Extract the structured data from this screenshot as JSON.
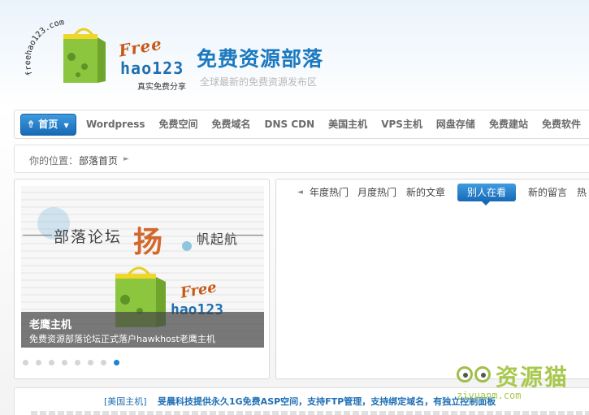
{
  "header": {
    "logo_arc_text": "freehao123.com",
    "logo_free": "Free",
    "logo_hao": "hao123",
    "logo_sub": "真实免费分享",
    "site_title": "免费资源部落",
    "site_subtitle": "全球最新的免费资源发布区"
  },
  "nav": {
    "home": "首页",
    "items": [
      "Wordpress",
      "免费空间",
      "免费域名",
      "DNS CDN",
      "美国主机",
      "VPS主机",
      "网盘存储",
      "免费建站",
      "免费软件"
    ]
  },
  "breadcrumb": {
    "label": "你的位置：",
    "current": "部落首页"
  },
  "slider": {
    "banner_text": "部落论坛",
    "banner_yang": "扬",
    "banner_fan": "帆起航",
    "caption_title": "老鹰主机",
    "caption_desc": "免费资源部落论坛正式落户hawkhost老鹰主机",
    "dot_count": 8,
    "active_dot": 7
  },
  "tabs": {
    "items": [
      "年度热门",
      "月度热门",
      "新的文章",
      "别人在看",
      "新的留言",
      "热"
    ],
    "active": "别人在看"
  },
  "watermark": {
    "text": "资源猫",
    "url": "ziyuanm.com"
  },
  "news": {
    "tag": "[美国主机]",
    "title": "旻晨科技提供永久1G免费ASP空间，支持FTP管理，支持绑定域名，有独立控制面板"
  },
  "colors": {
    "accent": "#1b79c0",
    "nav_active": "#1769b6",
    "logo_green": "#8cc63f",
    "logo_orange": "#c85a17"
  }
}
